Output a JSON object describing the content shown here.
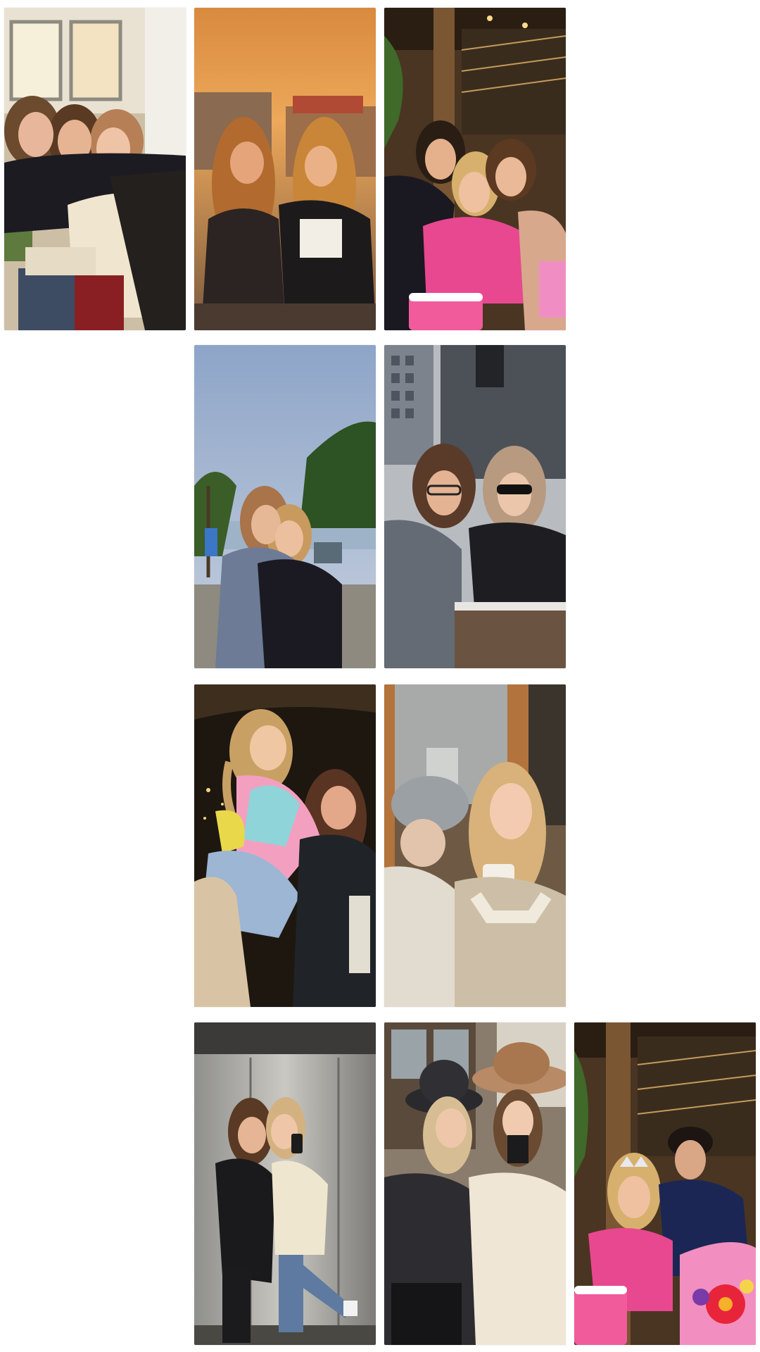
{
  "gallery": {
    "photos": [
      {
        "id": "p1",
        "subject": "three-friends-hug-indoors"
      },
      {
        "id": "p2",
        "subject": "two-friends-sunset-balcony"
      },
      {
        "id": "p3",
        "subject": "three-friends-birthday-cake-restaurant"
      },
      {
        "id": "p4",
        "subject": "two-friends-hug-seaside"
      },
      {
        "id": "p5",
        "subject": "two-friends-sunglasses-city"
      },
      {
        "id": "p6",
        "subject": "piggyback-night-laughing"
      },
      {
        "id": "p7",
        "subject": "friends-beanie-coffee-window"
      },
      {
        "id": "p8",
        "subject": "elevator-mirror-selfie"
      },
      {
        "id": "p9",
        "subject": "two-friends-hats-coats"
      },
      {
        "id": "p10",
        "subject": "birthday-girl-and-boy-flowers"
      }
    ]
  },
  "colors": {
    "background": "#ffffff",
    "sunset": "#e79a3c",
    "pink_dress": "#e8488f",
    "sky_blue": "#8ea5c8",
    "night": "#1d1710"
  }
}
